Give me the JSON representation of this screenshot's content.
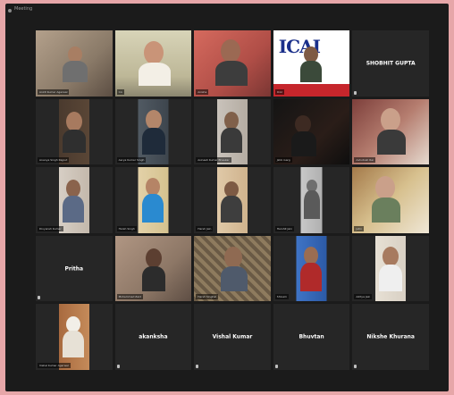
{
  "app": {
    "title": "Meeting"
  },
  "participants": [
    {
      "id": "p01",
      "display": "video",
      "caption": "Ankit Kumar Agarwal"
    },
    {
      "id": "p02",
      "display": "video",
      "caption": "CA",
      "active": true
    },
    {
      "id": "p03",
      "display": "video",
      "caption": "Anisha"
    },
    {
      "id": "p04",
      "display": "video",
      "caption": "ICAI",
      "logo": "ICAI"
    },
    {
      "id": "p05",
      "display": "name",
      "name": "SHOBHIT GUPTA",
      "caption": ""
    },
    {
      "id": "p06",
      "display": "video",
      "caption": "Ananya Singh Rajput"
    },
    {
      "id": "p07",
      "display": "video",
      "caption": "Aarya Kumar Singh"
    },
    {
      "id": "p08",
      "display": "video",
      "caption": "Avinash Kumar Bhaskar"
    },
    {
      "id": "p09",
      "display": "video",
      "caption": "Jatin Garg"
    },
    {
      "id": "p10",
      "display": "video",
      "caption": "Ashutosh Rai"
    },
    {
      "id": "p11",
      "display": "video",
      "caption": "Divyansh Kumar"
    },
    {
      "id": "p12",
      "display": "video",
      "caption": "Harsh Singh"
    },
    {
      "id": "p13",
      "display": "video",
      "caption": "Harsh Jain"
    },
    {
      "id": "p14",
      "display": "video",
      "caption": "Harshit Jain"
    },
    {
      "id": "p15",
      "display": "video",
      "caption": "Jatin"
    },
    {
      "id": "p16",
      "display": "name",
      "name": "Pritha",
      "caption": ""
    },
    {
      "id": "p17",
      "display": "video",
      "caption": "Mohammad Zaid"
    },
    {
      "id": "p18",
      "display": "video",
      "caption": "Harsh Singhal"
    },
    {
      "id": "p19",
      "display": "video",
      "caption": "Shivam"
    },
    {
      "id": "p20",
      "display": "video",
      "caption": "Aditya Jain"
    },
    {
      "id": "p21",
      "display": "video",
      "caption": "Vishal Kumar Agarwal"
    },
    {
      "id": "p22",
      "display": "name",
      "name": "akanksha",
      "caption": ""
    },
    {
      "id": "p23",
      "display": "name",
      "name": "Vishal Kumar",
      "caption": ""
    },
    {
      "id": "p24",
      "display": "name",
      "name": "Bhuvtan",
      "caption": ""
    },
    {
      "id": "p25",
      "display": "name",
      "name": "Nikshe Khurana",
      "caption": ""
    }
  ],
  "colors": {
    "frame": "#e6a6a8",
    "background": "#1b1b1b",
    "tile": "#262626",
    "active_speaker": "#7fd14a"
  }
}
